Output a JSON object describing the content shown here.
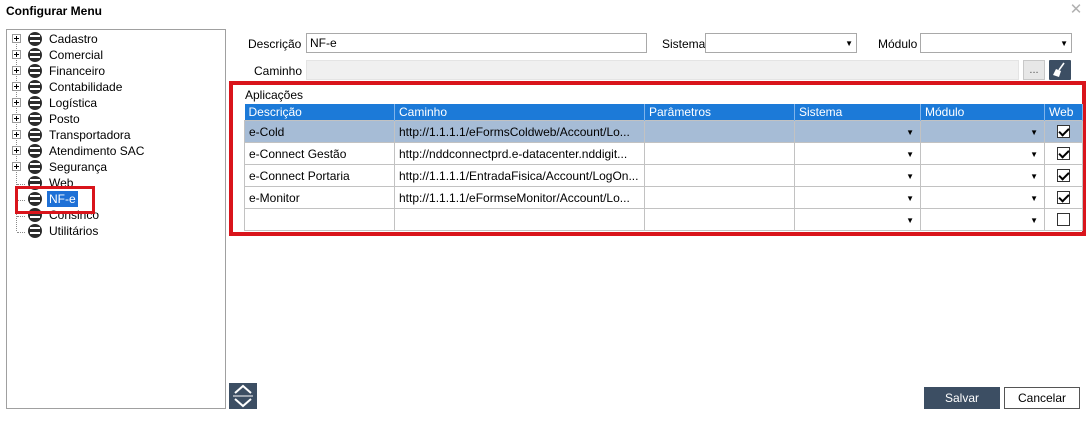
{
  "window": {
    "title": "Configurar Menu",
    "close_glyph": "✕"
  },
  "tree": {
    "items": [
      {
        "label": "Cadastro",
        "expandable": true
      },
      {
        "label": "Comercial",
        "expandable": true
      },
      {
        "label": "Financeiro",
        "expandable": true
      },
      {
        "label": "Contabilidade",
        "expandable": true
      },
      {
        "label": "Logística",
        "expandable": true
      },
      {
        "label": "Posto",
        "expandable": true
      },
      {
        "label": "Transportadora",
        "expandable": true
      },
      {
        "label": "Atendimento SAC",
        "expandable": true
      },
      {
        "label": "Segurança",
        "expandable": true
      },
      {
        "label": "Web",
        "expandable": false
      },
      {
        "label": "NF-e",
        "expandable": false,
        "selected": true
      },
      {
        "label": "Consinco",
        "expandable": false
      },
      {
        "label": "Utilitários",
        "expandable": false
      }
    ]
  },
  "form": {
    "descricao_label": "Descrição",
    "descricao_value": "NF-e",
    "sistema_label": "Sistema",
    "sistema_value": "",
    "modulo_label": "Módulo",
    "modulo_value": "",
    "caminho_label": "Caminho",
    "caminho_value": "",
    "browse_label": "..."
  },
  "aplicacoes": {
    "title": "Aplicações",
    "columns": [
      "Descrição",
      "Caminho",
      "Parâmetros",
      "Sistema",
      "Módulo",
      "Web"
    ],
    "rows": [
      {
        "descricao": "e-Cold",
        "caminho": "http://1.1.1.1/eFormsColdweb/Account/Lo...",
        "parametros": "",
        "sistema": "",
        "modulo": "",
        "web": true,
        "selected": true
      },
      {
        "descricao": "e-Connect Gestão",
        "caminho": "http://nddconnectprd.e-datacenter.nddigit...",
        "parametros": "",
        "sistema": "",
        "modulo": "",
        "web": true
      },
      {
        "descricao": "e-Connect Portaria",
        "caminho": "http://1.1.1.1/EntradaFisica/Account/LogOn...",
        "parametros": "",
        "sistema": "",
        "modulo": "",
        "web": true
      },
      {
        "descricao": "e-Monitor",
        "caminho": "http://1.1.1.1/eFormseMonitor/Account/Lo...",
        "parametros": "",
        "sistema": "",
        "modulo": "",
        "web": true
      },
      {
        "descricao": "",
        "caminho": "",
        "parametros": "",
        "sistema": "",
        "modulo": "",
        "web": false
      }
    ]
  },
  "buttons": {
    "save": "Salvar",
    "cancel": "Cancelar"
  },
  "icons": {
    "tree_node": "menu-list-icon",
    "clear": "broom-icon",
    "nav": "up-down-arrows-icon"
  },
  "colors": {
    "accent": "#1c7ad8",
    "highlight": "#d9141b",
    "button_dark": "#3c4e63",
    "selected_row": "#a6bcd6"
  }
}
